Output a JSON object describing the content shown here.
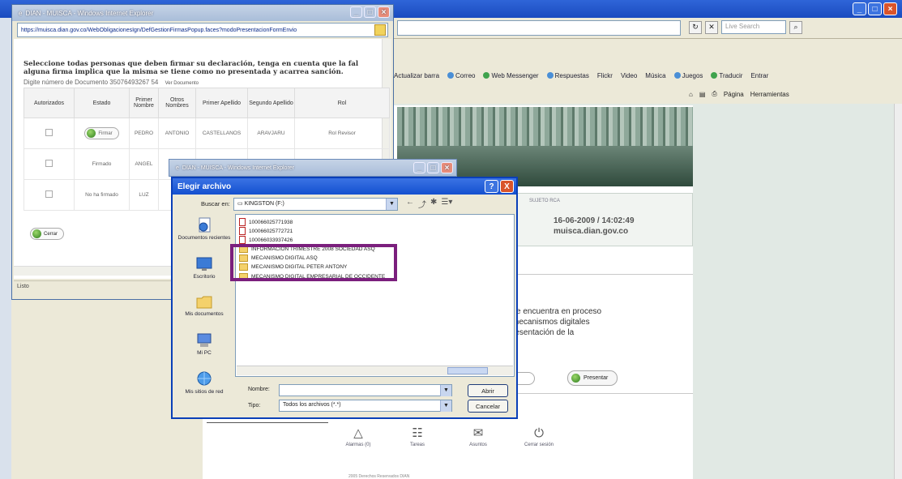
{
  "main": {
    "live_search_placeholder": "Live Search",
    "links": [
      "Actualizar barra",
      "Correo",
      "Web Messenger",
      "Respuestas",
      "Flickr",
      "Video",
      "Música",
      "Juegos",
      "Traducir",
      "Entrar"
    ],
    "cmd": [
      "Página",
      "Herramientas"
    ]
  },
  "popup1": {
    "title": "DIAN - MUISCA - Windows Internet Explorer",
    "url": "https://muisca.dian.gov.co/WebObligacionesIgn/DefGestionFirmasPopup.faces?modoPresentacionFormEnvio",
    "instruction": "Seleccione todas personas que deben firmar su declaración, tenga en cuenta que la fal alguna firma implica que la misma se tiene como no presentada y acarrea sanción.",
    "doc_label": "Digite número de Documento",
    "doc_number": "35076493267 54",
    "doc_link": "Ver Documento",
    "table": {
      "headers": [
        "Autorizados",
        "Estado",
        "Primer Nombre",
        "Otros Nombres",
        "Primer Apellido",
        "Segundo Apellido",
        "Rol"
      ],
      "rows": [
        {
          "estado": "Firmar",
          "nombre": "PEDRO",
          "otros": "ANTONIO",
          "apellido1": "CASTELLANOS",
          "apellido2": "ARAVJARU",
          "rol": "Rol Revisor"
        },
        {
          "estado": "Firmado",
          "nombre": "ANGEL",
          "otros": "",
          "apellido1": "",
          "apellido2": "",
          "rol": ""
        },
        {
          "estado": "No ha firmado",
          "nombre": "LUZ",
          "otros": "",
          "apellido1": "",
          "apellido2": "",
          "rol": ""
        }
      ]
    },
    "cerrar": "Cerrar",
    "status": "Listo"
  },
  "popup2": {
    "title": "DIAN - MUISCA - Windows Internet Explorer"
  },
  "dialog": {
    "title": "Elegir archivo",
    "help": "?",
    "close": "X",
    "lookin_label": "Buscar en:",
    "lookin_value": "KINGSTON (F:)",
    "places": [
      "Documentos recientes",
      "Escritorio",
      "Mis documentos",
      "Mi PC",
      "Mis sitios de red"
    ],
    "files": [
      {
        "name": "100066025771938",
        "type": "pdf"
      },
      {
        "name": "100066025772721",
        "type": "pdf"
      },
      {
        "name": "100066033937426",
        "type": "pdf"
      },
      {
        "name": "INFORMACIÓN TRIMESTRE 2008 SOCIEDAD ASQ",
        "type": "folder"
      },
      {
        "name": "MECANISMO DIGITAL ASQ",
        "type": "folder"
      },
      {
        "name": "MECANISMO DIGITAL PETER ANTONY",
        "type": "folder"
      },
      {
        "name": "MECANISMO DIGITAL EMPRESARIAL DE OCCIDENTE",
        "type": "folder"
      }
    ],
    "name_label": "Nombre:",
    "name_value": "",
    "type_label": "Tipo:",
    "type_value": "Todos los archivos (*.*)",
    "open_button": "Abrir",
    "cancel_button": "Cancelar"
  },
  "site": {
    "info_small": "SUJETO RCA",
    "datetime": "16-06-2009 / 14:02:49",
    "domain": "muisca.dian.gov.co",
    "message": [
      "se encuentra en proceso",
      "mecanismos digitales",
      "resentación de la"
    ],
    "presentar": "Presentar",
    "footer": [
      "Alarmas (0)",
      "Tareas",
      "Asuntos",
      "Cerrar sesión"
    ],
    "copyright": "2005 Derechos Reservados DIAN"
  },
  "colors": {
    "highlight": "#7b1f7d",
    "title_blue": "#1450cf"
  }
}
